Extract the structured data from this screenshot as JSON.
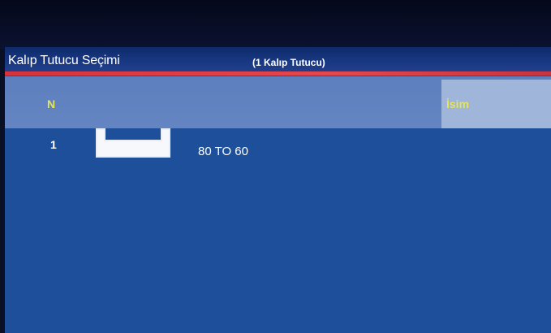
{
  "header": {
    "title": "Kalıp Tutucu Seçimi",
    "count": "(1 Kalıp Tutucu)"
  },
  "table": {
    "columns": [
      "N",
      "İsim"
    ],
    "rows": [
      {
        "n": "1",
        "name": "80 TO 60",
        "icon": "die-holder-icon"
      }
    ]
  },
  "colors": {
    "screen_bg": "#1d4f9a",
    "header_row": "#6485c2",
    "accent_red": "#e6474c",
    "header_text": "#e6e35a"
  }
}
